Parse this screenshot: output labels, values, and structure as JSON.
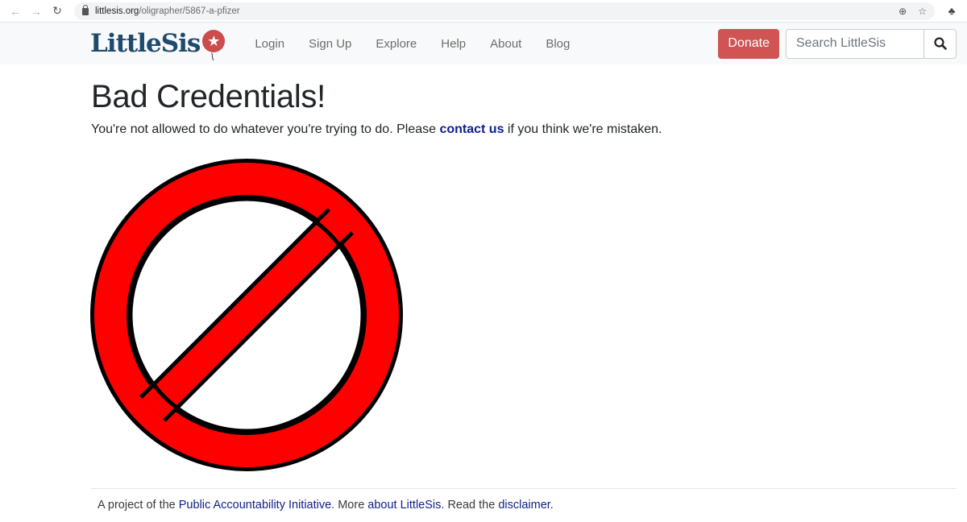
{
  "browser": {
    "url_host": "littlesis.org",
    "url_path": "/oligrapher/5867-a-pfizer"
  },
  "nav": {
    "logo_text": "LittleSis",
    "links": [
      "Login",
      "Sign Up",
      "Explore",
      "Help",
      "About",
      "Blog"
    ],
    "donate_label": "Donate",
    "search_placeholder": "Search LittleSis"
  },
  "main": {
    "title": "Bad Credentials!",
    "message_before": "You're not allowed to do whatever you're trying to do. Please ",
    "message_link": "contact us",
    "message_after": " if you think we're mistaken."
  },
  "footer": {
    "text1": "A project of the ",
    "link1": "Public Accountability Initiative",
    "text2": ". More ",
    "link2": "about LittleSis",
    "text3": ". Read the ",
    "link3": "disclaimer",
    "text4": "."
  },
  "colors": {
    "brand": "#1e4a6e",
    "donate": "#d05454",
    "link": "#0b1e8e",
    "prohibition_red": "#ff0000"
  }
}
